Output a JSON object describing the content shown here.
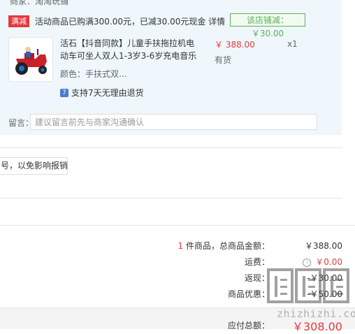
{
  "shop": {
    "name": "商家：淘淘玩铺",
    "promo_tag": "满减",
    "promo_text": "活动商品已购满300.00元，已减30.00元现金 详情",
    "discount_badge": "该店铺减：￥30.00"
  },
  "product": {
    "title": "活石【抖音同款】儿童手扶拖拉机电动车可坐人双人1-3岁3-6岁充电音乐",
    "color": "颜色：手扶式双...",
    "return_policy": "支持7天无理由退货",
    "return_icon": "7",
    "price": "￥ 388.00",
    "stock": "有货",
    "quantity": "x1"
  },
  "message": {
    "label": "留言：",
    "placeholder": "建议留言前先与商家沟通确认"
  },
  "invoice": {
    "button_text": "号，以免影响报销"
  },
  "summary": {
    "items_count": "1",
    "items_label": "件商品，总商品金额：",
    "items_total": "￥388.00",
    "shipping_label": "运费：",
    "shipping_info_icon": "!",
    "shipping_value": "￥0.00",
    "discount_label": "返现：",
    "discount_value": "-￥30.00",
    "deduction_label": "商品优惠：",
    "deduction_value": "-￥50.00",
    "payable_label": "应付总额：",
    "payable_value": "￥308.00"
  },
  "watermark": {
    "text": "zhizhizhi.com",
    "logo_glyph": "值值值"
  },
  "colors": {
    "accent_red": "#e4393c",
    "discount_green": "#5bb15b",
    "shop_background": "#eff7fd"
  }
}
